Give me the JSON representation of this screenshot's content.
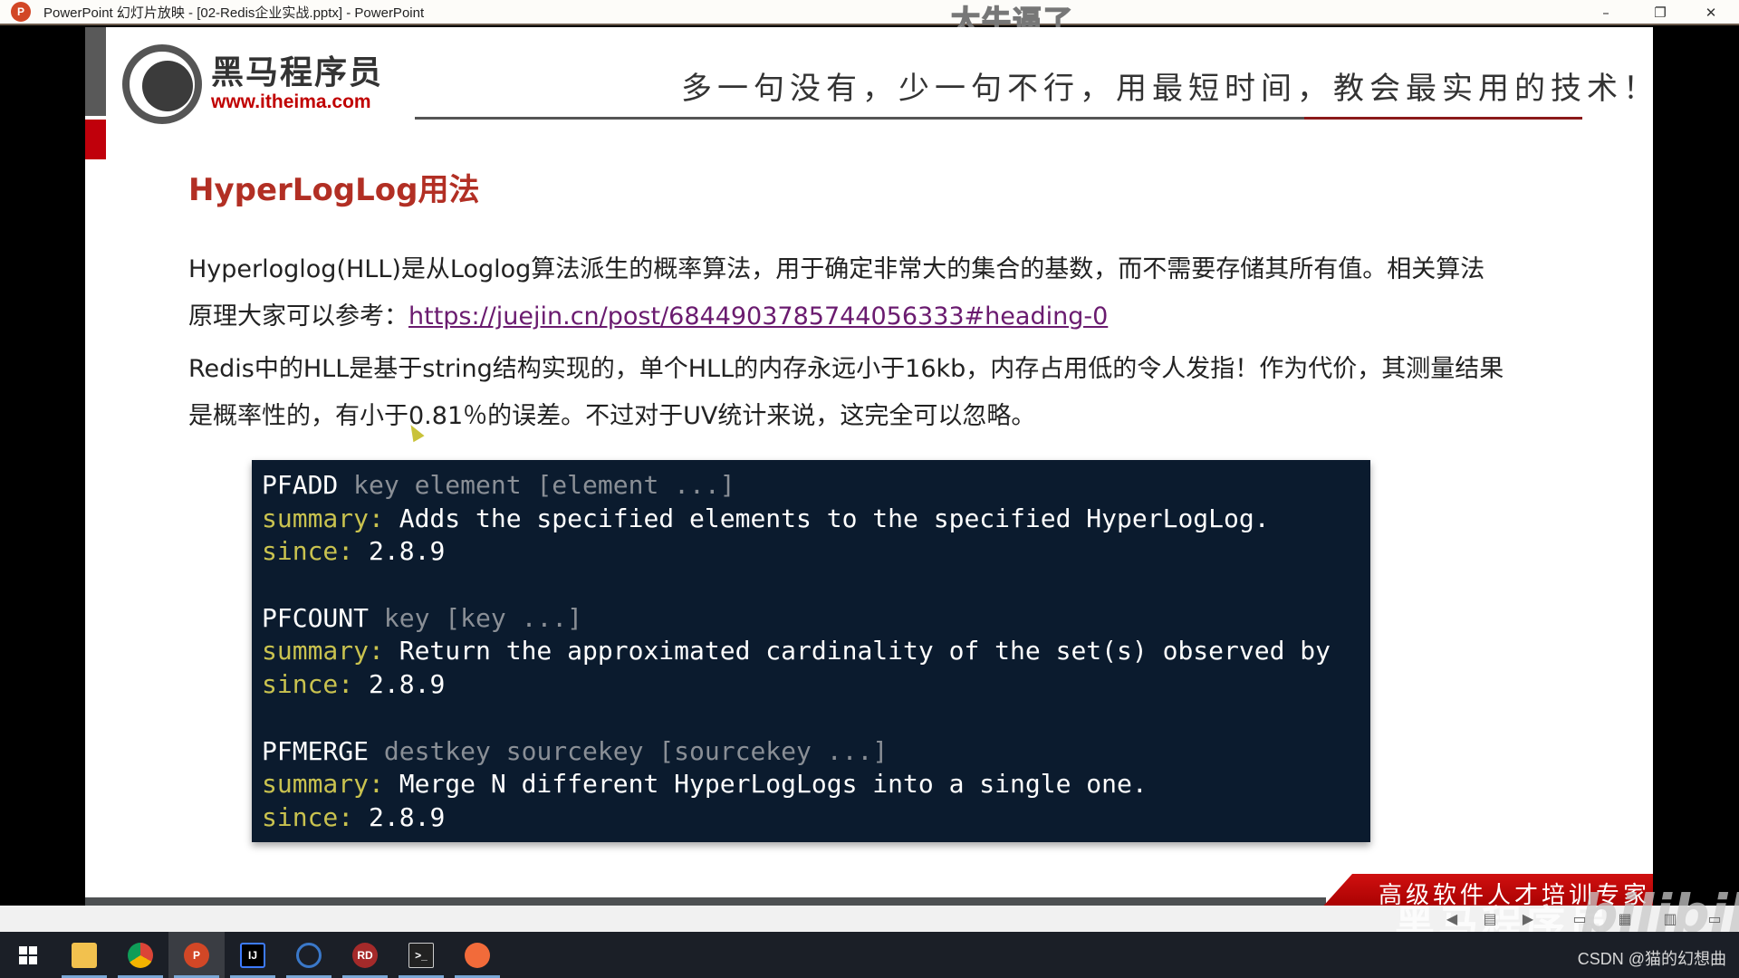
{
  "window": {
    "title": "PowerPoint 幻灯片放映 - [02-Redis企业实战.pptx] - PowerPoint",
    "app_icon_letter": "P",
    "controls": {
      "minimize": "–",
      "restore": "❐",
      "close": "✕"
    },
    "overlay_caption": "太牛逼了"
  },
  "slide": {
    "logo": {
      "brand": "黑马程序员",
      "url": "www.itheima.com"
    },
    "tagline": "多一句没有，少一句不行，用最短时间，教会最实用的技术！",
    "heading": "HyperLogLog用法",
    "paragraphs": [
      {
        "line1": "Hyperloglog(HLL)是从Loglog算法派生的概率算法，用于确定非常大的集合的基数，而不需要存储其所有值。相关算法",
        "line2_prefix": "原理大家可以参考：",
        "link": "https://juejin.cn/post/6844903785744056333#heading-0"
      },
      {
        "line1": "Redis中的HLL是基于string结构实现的，单个HLL的内存永远小于16kb，内存占用低的令人发指！作为代价，其测量结果",
        "line2": "是概率性的，有小于0.81％的误差。不过对于UV统计来说，这完全可以忽略。"
      }
    ],
    "commands": [
      {
        "name": "PFADD",
        "args": "key element [element ...]",
        "summary_label": "summary:",
        "summary": "Adds the specified elements to the specified HyperLogLog.",
        "since_label": "since:",
        "since": "2.8.9"
      },
      {
        "name": "PFCOUNT",
        "args": "key [key ...]",
        "summary_label": "summary:",
        "summary": "Return the approximated cardinality of the set(s) observed by",
        "since_label": "since:",
        "since": "2.8.9"
      },
      {
        "name": "PFMERGE",
        "args": "destkey sourcekey [sourcekey ...]",
        "summary_label": "summary:",
        "summary": "Merge N different HyperLogLogs into a single one.",
        "since_label": "since:",
        "since": "2.8.9"
      }
    ],
    "ribbon": "高级软件人才培训专家"
  },
  "slideshow_controls": {
    "prev": "◀",
    "menu": "▤",
    "next": "▶",
    "normal_view": "▭",
    "sorter_view": "▦",
    "reading_view": "▥",
    "presenter_view": "▭"
  },
  "watermark": {
    "brand": "黑马程序员",
    "bilibili": "bilibili"
  },
  "taskbar": {
    "items": [
      {
        "name": "start",
        "label": ""
      },
      {
        "name": "file-explorer",
        "label": ""
      },
      {
        "name": "chrome",
        "label": ""
      },
      {
        "name": "powerpoint",
        "label": "P"
      },
      {
        "name": "intellij-idea",
        "label": "IJ"
      },
      {
        "name": "netbeans",
        "label": ""
      },
      {
        "name": "redis-desktop",
        "label": "RD"
      },
      {
        "name": "terminal",
        "label": ">_"
      },
      {
        "name": "postman",
        "label": ""
      }
    ],
    "corner_text": "CSDN @猫的幻想曲"
  },
  "colors": {
    "heading": "#b22f24",
    "link": "#6a1b6f",
    "code_bg": "#0b1b2e",
    "code_label": "#c9c24f",
    "code_args": "#8a8f96",
    "ribbon": "#c00000"
  }
}
